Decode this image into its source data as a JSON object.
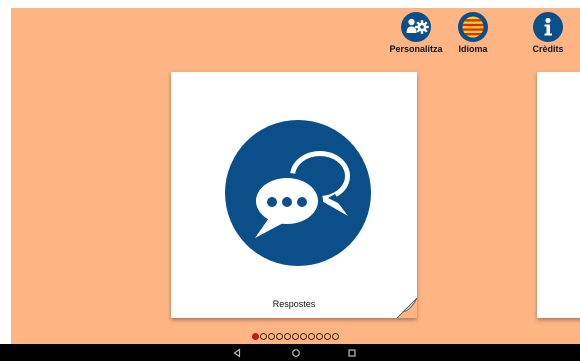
{
  "toolbar": {
    "personalize_label": "Personalitza",
    "language_label": "Idioma",
    "credits_label": "Crèdits"
  },
  "cards": [
    {
      "label": "Respostes",
      "icon": "speech-bubbles-icon"
    }
  ],
  "pager": {
    "total": 11,
    "current": 1
  },
  "colors": {
    "background": "#ffb583",
    "icon_blue": "#0b4f8a",
    "active_dot": "#b71c1c",
    "flag_red": "#d62b1f",
    "flag_yellow": "#fcd116"
  },
  "navbar": {
    "buttons": [
      "back-icon",
      "home-icon",
      "recents-icon"
    ]
  }
}
